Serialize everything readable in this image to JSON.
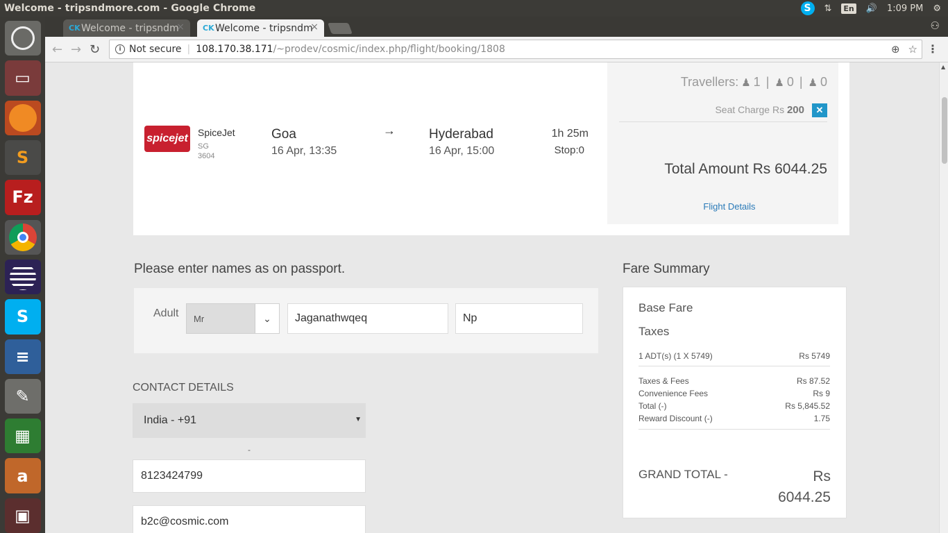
{
  "os": {
    "window_title": "Welcome - tripsndmore.com - Google Chrome",
    "lang": "En",
    "time": "1:09 PM",
    "launcher": [
      "ubuntu",
      "files",
      "firefox",
      "sublime-text",
      "filezilla",
      "chrome",
      "eclipse",
      "skype",
      "writer",
      "gedit",
      "calc",
      "amazon",
      "screenshot"
    ]
  },
  "browser": {
    "tabs": [
      {
        "label": "Welcome - tripsndm",
        "active": false
      },
      {
        "label": "Welcome - tripsndm",
        "active": true
      }
    ],
    "security": "Not secure",
    "url_host": "108.170.38.171",
    "url_path": "/~prodev/cosmic/index.php/flight/booking/1808"
  },
  "flight": {
    "airline_logo_text": "spicejet",
    "airline_name": "SpiceJet",
    "airline_code": "SG",
    "flight_number": "3604",
    "from_city": "Goa",
    "from_time": "16 Apr, 13:35",
    "arrow": "→",
    "to_city": "Hyderabad",
    "to_time": "16 Apr, 15:00",
    "duration": "1h 25m",
    "stops": "Stop:0"
  },
  "price_panel": {
    "travellers_label": "Travellers:",
    "adults": "1",
    "children": "0",
    "infants": "0",
    "seat_charge_label": "Seat Charge Rs",
    "seat_charge_value": "200",
    "total_amount": "Total Amount Rs 6044.25",
    "flight_details_link": "Flight Details"
  },
  "passport": {
    "heading": "Please enter names as on passport.",
    "adult_label": "Adult",
    "title_value": "Mr",
    "first_name": "Jaganathwqeq",
    "last_name": "Np"
  },
  "contact": {
    "heading": "CONTACT DETAILS",
    "country_code": "India - +91",
    "dash": "-",
    "phone": "8123424799",
    "email": "b2c@cosmic.com"
  },
  "fare_summary": {
    "heading": "Fare Summary",
    "base_fare_label": "Base Fare",
    "taxes_label": "Taxes",
    "rows": [
      {
        "label": "1 ADT(s) (1 X 5749)",
        "value": "Rs 5749"
      },
      {
        "label": "Taxes & Fees",
        "value": "Rs 87.52"
      },
      {
        "label": "Convenience Fees",
        "value": "Rs 9"
      },
      {
        "label": "Total (-)",
        "value": "Rs 5,845.52"
      },
      {
        "label": "Reward Discount (-)",
        "value": "1.75"
      }
    ],
    "grand_total_label": "GRAND TOTAL -",
    "grand_total_currency": "Rs",
    "grand_total_value": "6044.25"
  },
  "colors": {
    "link": "#2a7ab8",
    "close_button": "#2196c9",
    "spicejet_red": "#c8202f"
  }
}
